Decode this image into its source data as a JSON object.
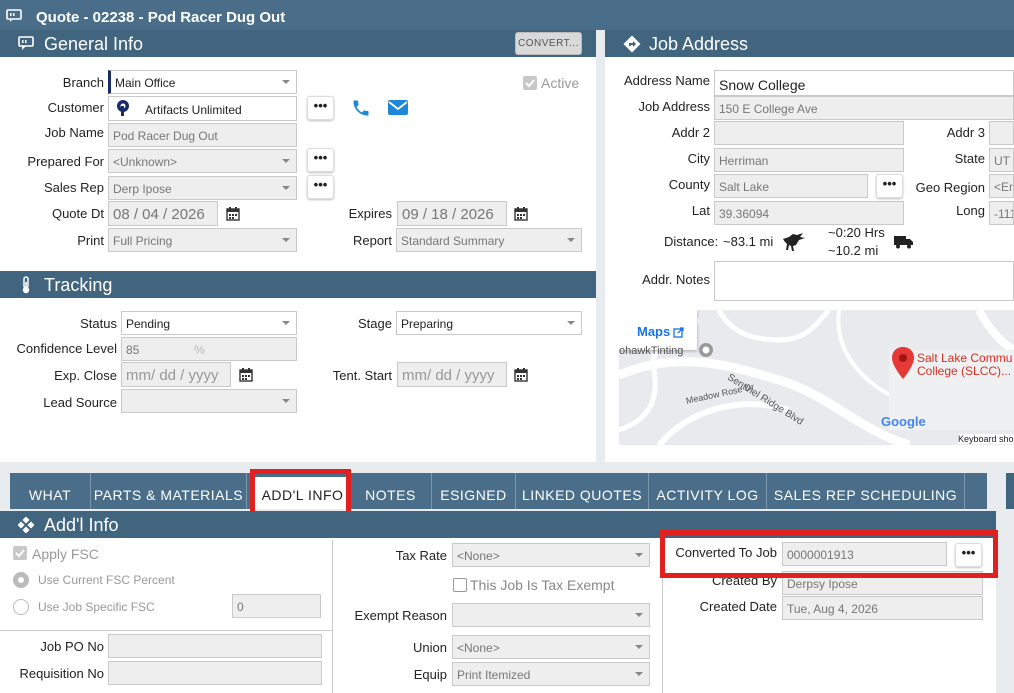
{
  "window": {
    "title": "Quote - 02238 - Pod Racer Dug Out"
  },
  "general_info": {
    "title": "General Info",
    "convert_label": "CONVERT...",
    "active_label": "Active",
    "branch_label": "Branch",
    "branch_value": "Main Office",
    "customer_label": "Customer",
    "customer_value": "Artifacts Unlimited",
    "job_name_label": "Job Name",
    "job_name_value": "Pod Racer Dug Out",
    "prepared_for_label": "Prepared For",
    "prepared_for_value": "<Unknown>",
    "sales_rep_label": "Sales Rep",
    "sales_rep_value": "Derp Ipose",
    "quote_dt_label": "Quote Dt",
    "quote_dt_value": "08 / 04 / 2026",
    "expires_label": "Expires",
    "expires_value": "09 / 18 / 2026",
    "print_label": "Print",
    "print_value": "Full Pricing",
    "report_label": "Report",
    "report_value": "Standard Summary",
    "ellipsis": "•••"
  },
  "tracking": {
    "title": "Tracking",
    "status_label": "Status",
    "status_value": "Pending",
    "stage_label": "Stage",
    "stage_value": "Preparing",
    "confidence_label": "Confidence Level",
    "confidence_value": "85",
    "confidence_unit": "%",
    "exp_close_label": "Exp. Close",
    "exp_close_placeholder": "mm/ dd / yyyy",
    "tent_start_label": "Tent. Start",
    "tent_start_placeholder": "mm/ dd / yyyy",
    "lead_source_label": "Lead Source"
  },
  "job_address": {
    "title": "Job Address",
    "address_name_label": "Address Name",
    "address_name_value": "Snow College",
    "job_address_label": "Job Address",
    "job_address_value": "150 E College Ave",
    "addr2_label": "Addr 2",
    "addr3_label": "Addr 3",
    "city_label": "City",
    "city_value": "Herriman",
    "state_label": "State",
    "state_value": "UT",
    "county_label": "County",
    "county_value": "Salt Lake",
    "geo_region_label": "Geo Region",
    "geo_region_value": "<Em",
    "lat_label": "Lat",
    "lat_value": "39.36094",
    "long_label": "Long",
    "long_value": "-111",
    "distance_label": "Distance:",
    "distance_value": "~83.1 mi",
    "drive_time": "~0:20 Hrs",
    "drive_distance": "~10.2 mi",
    "addr_notes_label": "Addr. Notes",
    "map": {
      "maps_link": "Maps",
      "poi_left": "ohawkTinting",
      "poi_right_1": "Salt Lake Commu",
      "poi_right_2": "College (SLCC)...",
      "street_1": "Sentinel Ridge Blvd",
      "street_2": "Meadow Rose Dr",
      "google": "Google",
      "shortcuts": "Keyboard sho"
    }
  },
  "tabs": [
    {
      "label": "WHAT"
    },
    {
      "label": "PARTS & MATERIALS"
    },
    {
      "label": "ADD'L INFO"
    },
    {
      "label": "NOTES"
    },
    {
      "label": "ESIGNED"
    },
    {
      "label": "LINKED QUOTES"
    },
    {
      "label": "ACTIVITY LOG"
    },
    {
      "label": "SALES REP SCHEDULING"
    }
  ],
  "addl_info": {
    "title": "Add'l Info",
    "apply_fsc_label": "Apply FSC",
    "use_current_fsc_label": "Use Current FSC Percent",
    "use_job_fsc_label": "Use Job Specific FSC",
    "use_job_fsc_value": "0",
    "tax_rate_label": "Tax Rate",
    "tax_rate_value": "<None>",
    "tax_exempt_label": "This Job Is Tax Exempt",
    "exempt_reason_label": "Exempt Reason",
    "converted_to_job_label": "Converted To Job",
    "converted_to_job_value": "0000001913",
    "created_by_label": "Created By",
    "created_by_value": "Derpsy Ipose",
    "created_date_label": "Created Date",
    "created_date_value": "Tue, Aug 4, 2026",
    "job_po_label": "Job PO No",
    "requisition_label": "Requisition No",
    "union_label": "Union",
    "union_value": "<None>",
    "equip_label": "Equip",
    "equip_value": "Print Itemized"
  },
  "colors": {
    "header": "#42657f",
    "tab_bar": "#4a6e89",
    "highlight": "#e12020",
    "link": "#1a73e8"
  }
}
